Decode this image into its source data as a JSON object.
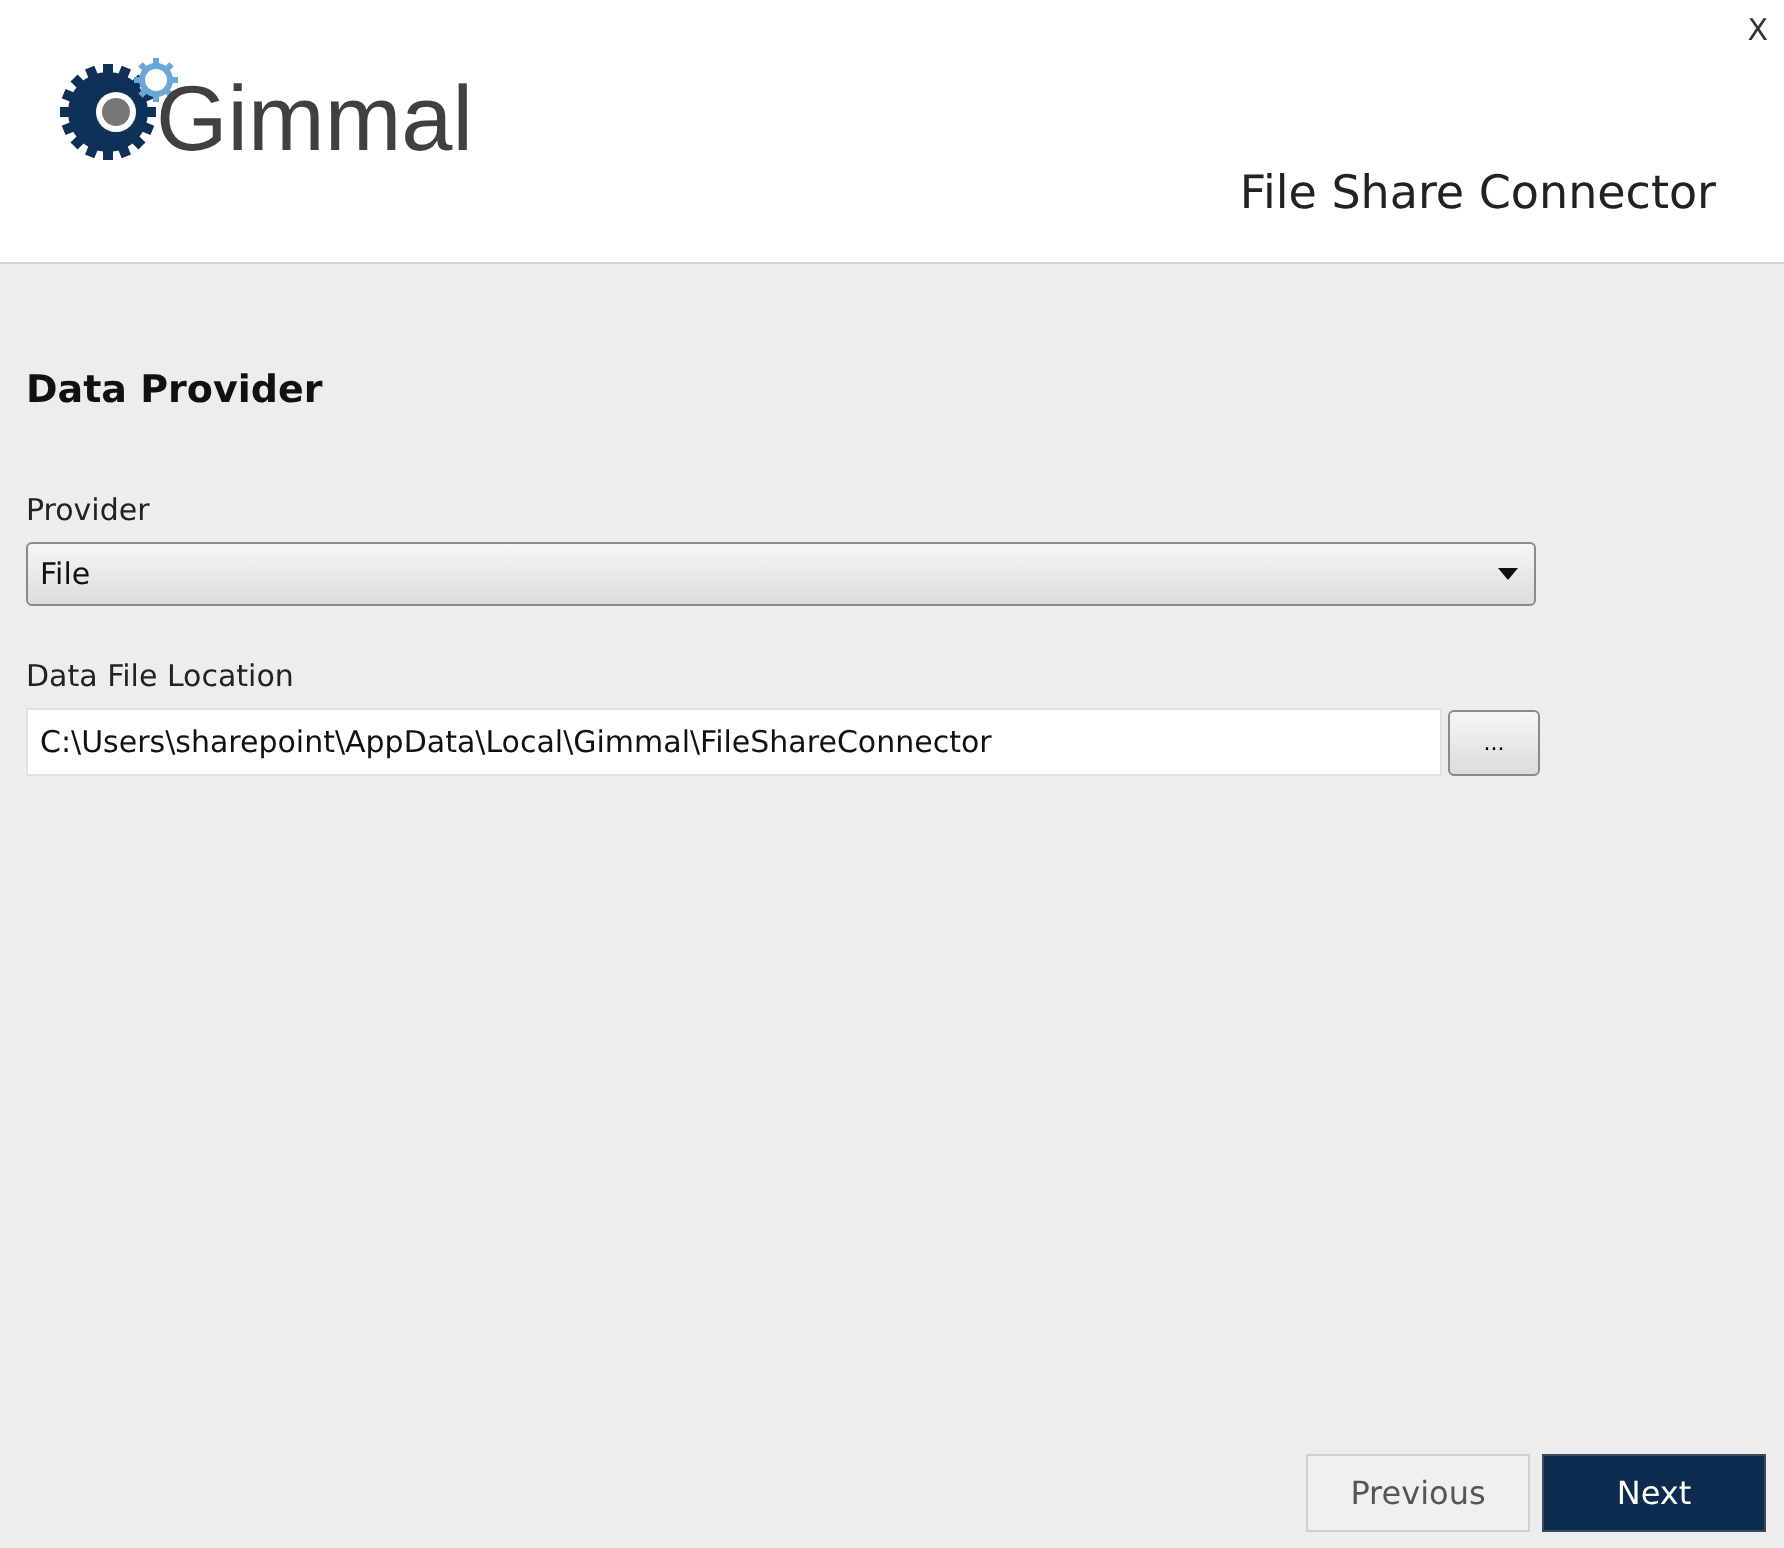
{
  "header": {
    "logo_text": "Gimmal",
    "title": "File Share Connector",
    "close": "X"
  },
  "section": {
    "heading": "Data Provider",
    "fields": [
      {
        "kind": "dropdown",
        "label": "Provider",
        "value": "File"
      },
      {
        "kind": "path",
        "label": "Data File Location",
        "value": "C:\\Users\\sharepoint\\AppData\\Local\\Gimmal\\FileShareConnector",
        "browse": "..."
      }
    ]
  },
  "buttons": [
    {
      "label": "Previous",
      "primary": false
    },
    {
      "label": "Next",
      "primary": true
    }
  ]
}
